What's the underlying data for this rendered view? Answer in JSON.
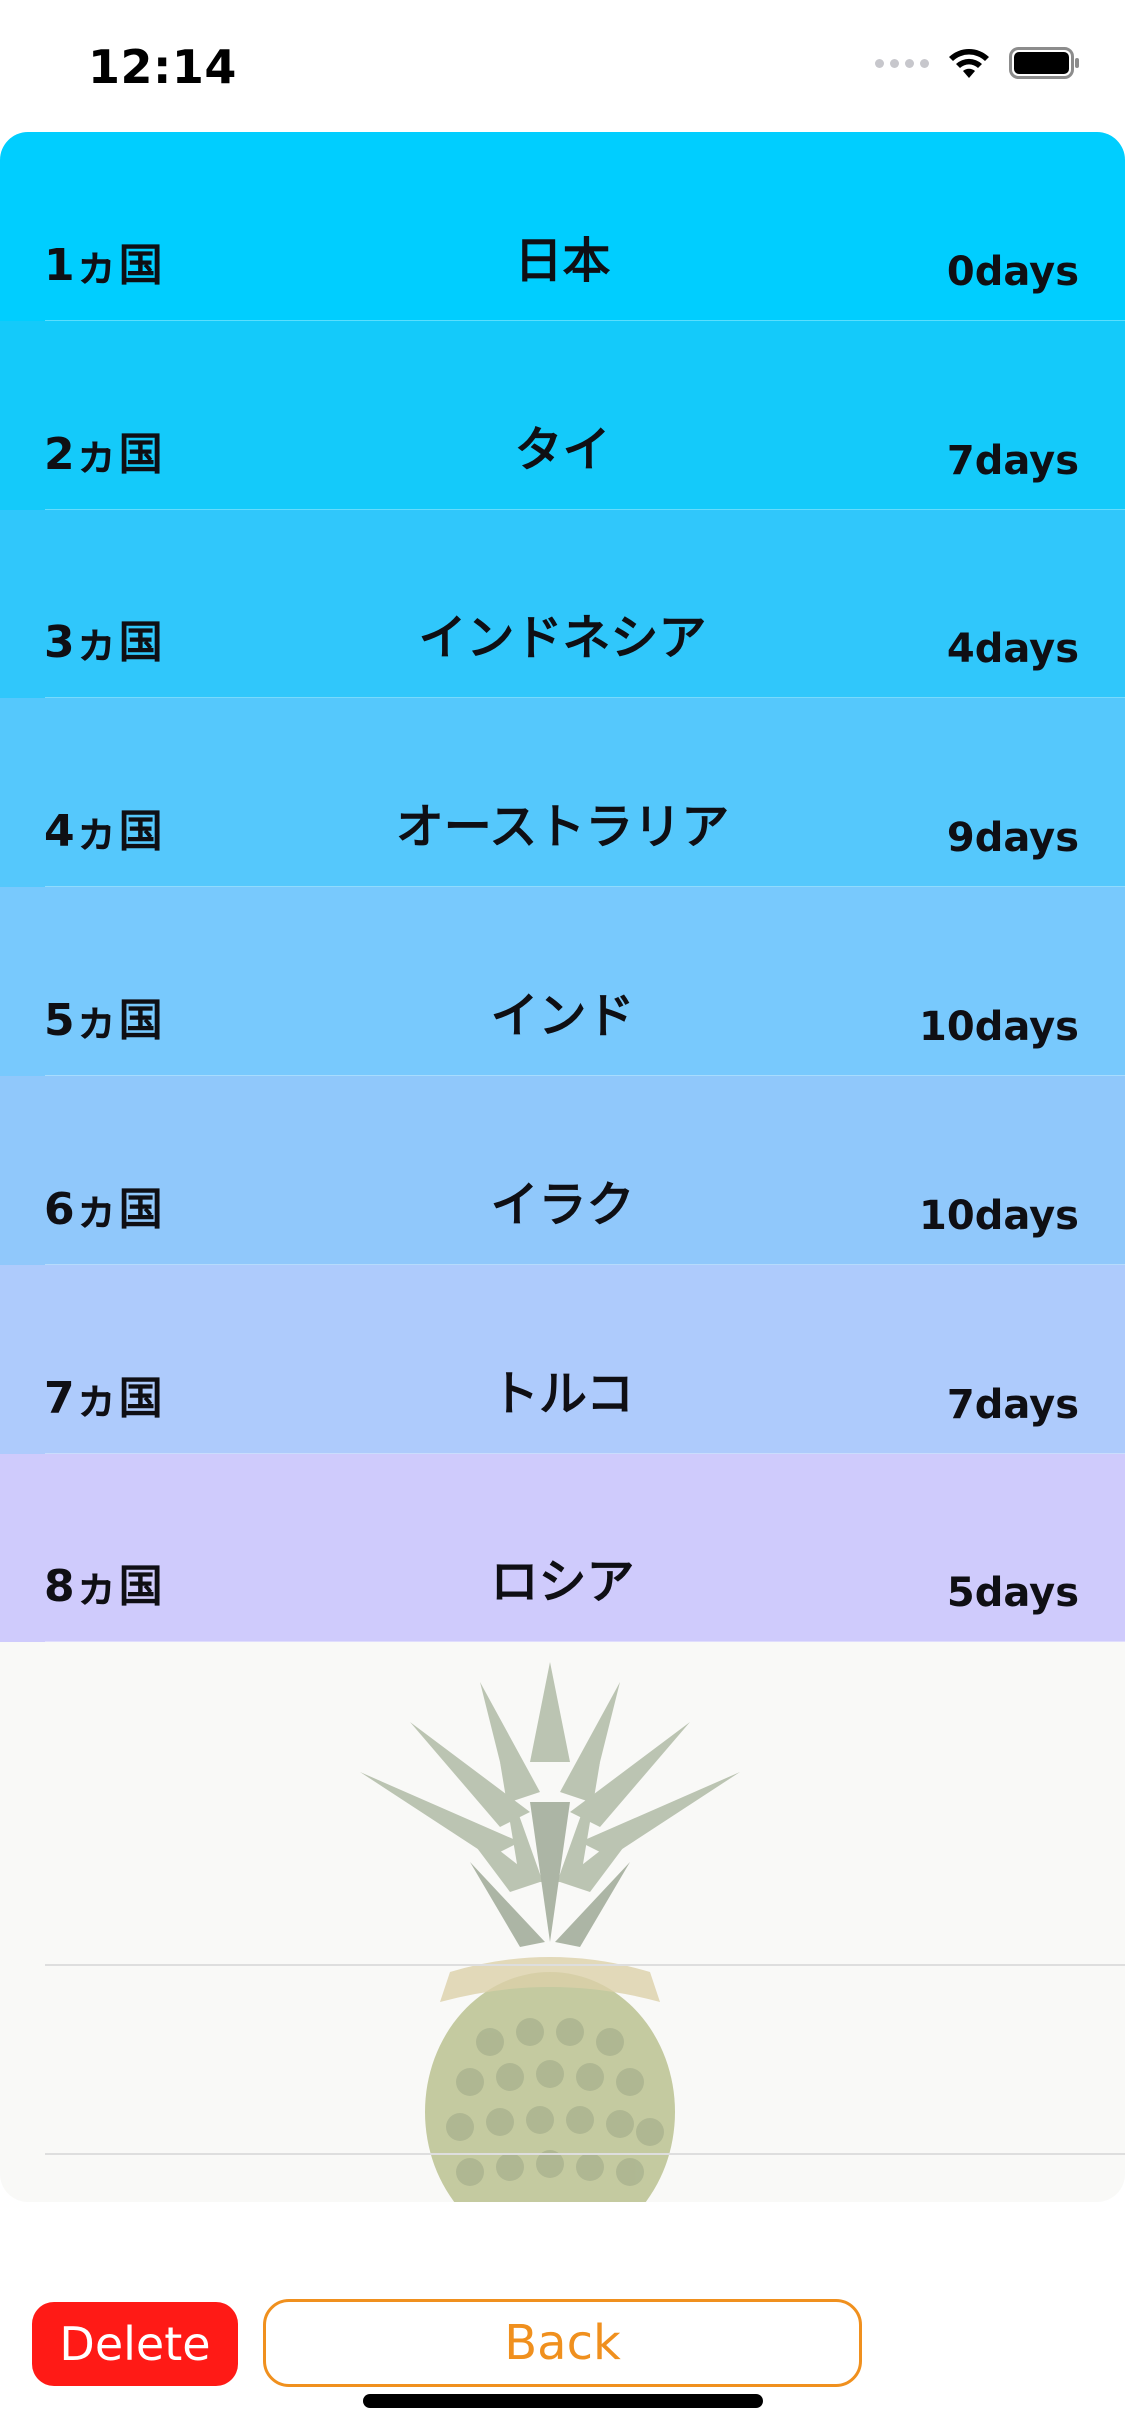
{
  "status_bar": {
    "time": "12:14"
  },
  "trips": [
    {
      "index": "1ヵ国",
      "country": "日本",
      "days": "0days",
      "color": "#00ceff"
    },
    {
      "index": "2ヵ国",
      "country": "タイ",
      "days": "7days",
      "color": "#14cafa"
    },
    {
      "index": "3ヵ国",
      "country": "インドネシア",
      "days": "4days",
      "color": "#30c7fb"
    },
    {
      "index": "4ヵ国",
      "country": "オーストラリア",
      "days": "9days",
      "color": "#55c8fc"
    },
    {
      "index": "5ヵ国",
      "country": "インド",
      "days": "10days",
      "color": "#78c9fd"
    },
    {
      "index": "6ヵ国",
      "country": "イラク",
      "days": "10days",
      "color": "#90c8fb"
    },
    {
      "index": "7ヵ国",
      "country": "トルコ",
      "days": "7days",
      "color": "#aecbfc"
    },
    {
      "index": "8ヵ国",
      "country": "ロシア",
      "days": "5days",
      "color": "#cfcbfc"
    }
  ],
  "buttons": {
    "delete_label": "Delete",
    "back_label": "Back",
    "delete_color": "#ff1a16",
    "back_color": "#f0901e"
  },
  "icons": {
    "background_image": "pineapple-image",
    "wifi": "wifi-icon",
    "battery": "battery-icon",
    "signal": "signal-icon"
  }
}
